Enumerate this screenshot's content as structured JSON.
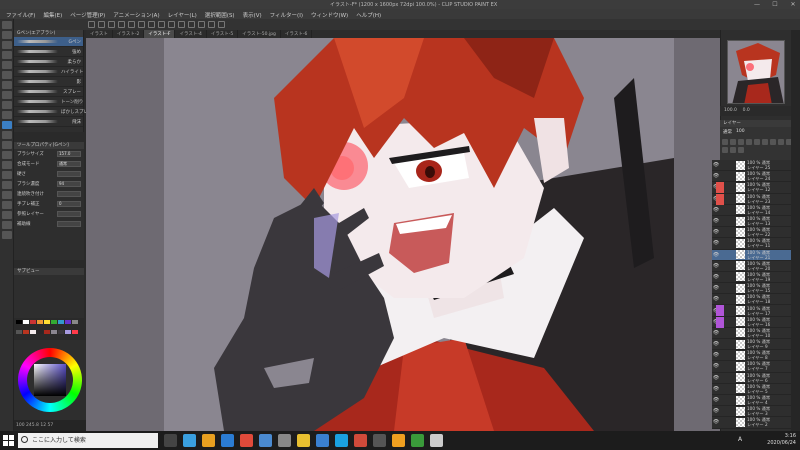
{
  "window": {
    "title": "イラスト-F* (1200 x 1600px 72dpi 100.0%)  - CLIP STUDIO PAINT EX",
    "min": "—",
    "max": "☐",
    "close": "✕"
  },
  "menu": [
    "ファイル(F)",
    "編集(E)",
    "ページ管理(P)",
    "アニメーション(A)",
    "レイヤー(L)",
    "選択範囲(S)",
    "表示(V)",
    "フィルター(I)",
    "ウィンドウ(W)",
    "ヘルプ(H)"
  ],
  "tabs": [
    {
      "label": "イラスト",
      "active": false
    },
    {
      "label": "イラスト-2",
      "active": false
    },
    {
      "label": "イラスト-F",
      "active": true
    },
    {
      "label": "イラスト-4",
      "active": false
    },
    {
      "label": "イラスト-5",
      "active": false
    },
    {
      "label": "イラスト-50.jpg",
      "active": false
    },
    {
      "label": "イラスト-6",
      "active": false
    }
  ],
  "subtool": {
    "header": "Gペン(エアブラシ)",
    "brushes": [
      {
        "name": "Gペン",
        "selected": true
      },
      {
        "name": "強め",
        "selected": false
      },
      {
        "name": "柔らか",
        "selected": false
      },
      {
        "name": "ハイライト",
        "selected": false
      },
      {
        "name": "影",
        "selected": false
      },
      {
        "name": "スプレー",
        "selected": false
      },
      {
        "name": "トーン削り",
        "selected": false
      },
      {
        "name": "ぼかしスプレー",
        "selected": false
      },
      {
        "name": "飛沫",
        "selected": false
      }
    ]
  },
  "toolprop": {
    "header": "ツールプロパティ[Gペン]",
    "rows": [
      {
        "label": "ブラシサイズ",
        "value": "157.0"
      },
      {
        "label": "合成モード",
        "value": "通常"
      },
      {
        "label": "硬さ",
        "value": ""
      },
      {
        "label": "ブラシ濃度",
        "value": "94"
      },
      {
        "label": "連続吹き付け",
        "value": ""
      },
      {
        "label": "手ブレ補正",
        "value": "0"
      },
      {
        "label": "参照レイヤー",
        "value": ""
      },
      {
        "label": "補助線",
        "value": ""
      }
    ]
  },
  "brushsize": {
    "header": "ブラシサイズ",
    "sizes": [
      "0.7",
      "1",
      "1.5",
      "2",
      "2.5",
      "3",
      "4",
      "5",
      "6",
      "7",
      "8",
      "10",
      "12",
      "15",
      "17",
      "20",
      "25",
      "30",
      "40",
      "50",
      "60",
      "70",
      "80",
      "100",
      "120",
      "150",
      "170",
      "200",
      "250",
      "300"
    ]
  },
  "left_bottom": {
    "sublayer_header": "サブビュー",
    "status": "100  245.8  12  57"
  },
  "right": {
    "nav_header": "ナビゲーター",
    "zoom": "100.0",
    "angle": "0.0",
    "layer_header": "レイヤー",
    "blend": "通常",
    "opacity": "100"
  },
  "layers": [
    {
      "name": "レイヤー 25",
      "mode": "100 % 通常",
      "selected": false
    },
    {
      "name": "レイヤー 24",
      "mode": "100 % 通常",
      "selected": false
    },
    {
      "name": "レイヤー 12",
      "mode": "100 % 通常",
      "selected": false
    },
    {
      "name": "レイヤー 23",
      "mode": "100 % 通常",
      "selected": false
    },
    {
      "name": "レイヤー 14",
      "mode": "100 % 通常",
      "selected": false
    },
    {
      "name": "レイヤー 13",
      "mode": "100 % 通常",
      "selected": false
    },
    {
      "name": "レイヤー 22",
      "mode": "100 % 通常",
      "selected": false
    },
    {
      "name": "レイヤー 11",
      "mode": "100 % 通常",
      "selected": false
    },
    {
      "name": "レイヤー 21",
      "mode": "100 % 通常",
      "selected": true
    },
    {
      "name": "レイヤー 20",
      "mode": "100 % 通常",
      "selected": false
    },
    {
      "name": "レイヤー 19",
      "mode": "100 % 通常",
      "selected": false
    },
    {
      "name": "レイヤー 15",
      "mode": "100 % 通常",
      "selected": false
    },
    {
      "name": "レイヤー 18",
      "mode": "100 % 通常",
      "selected": false
    },
    {
      "name": "レイヤー 17",
      "mode": "100 % 通常",
      "selected": false
    },
    {
      "name": "レイヤー 16",
      "mode": "100 % 通常",
      "selected": false
    },
    {
      "name": "レイヤー 10",
      "mode": "100 % 通常",
      "selected": false
    },
    {
      "name": "レイヤー 9",
      "mode": "100 % 通常",
      "selected": false
    },
    {
      "name": "レイヤー 8",
      "mode": "100 % 通常",
      "selected": false
    },
    {
      "name": "レイヤー 7",
      "mode": "100 % 通常",
      "selected": false
    },
    {
      "name": "レイヤー 6",
      "mode": "100 % 通常",
      "selected": false
    },
    {
      "name": "レイヤー 5",
      "mode": "100 % 通常",
      "selected": false
    },
    {
      "name": "レイヤー 4",
      "mode": "100 % 通常",
      "selected": false
    },
    {
      "name": "レイヤー 3",
      "mode": "100 % 通常",
      "selected": false
    },
    {
      "name": "レイヤー 2",
      "mode": "100 % 通常",
      "selected": false
    }
  ],
  "taskbar": {
    "search_placeholder": "ここに入力して検索",
    "time": "3:16",
    "date": "2020/06/24",
    "ime": "A"
  },
  "colors": {
    "accent": "#3b7fc4",
    "layer_selected": "#4a6a92",
    "canvas_bg": "#8a8690",
    "hair": "#b8341f",
    "red_tag": "#e0504a",
    "purple_tag": "#b055d8"
  }
}
